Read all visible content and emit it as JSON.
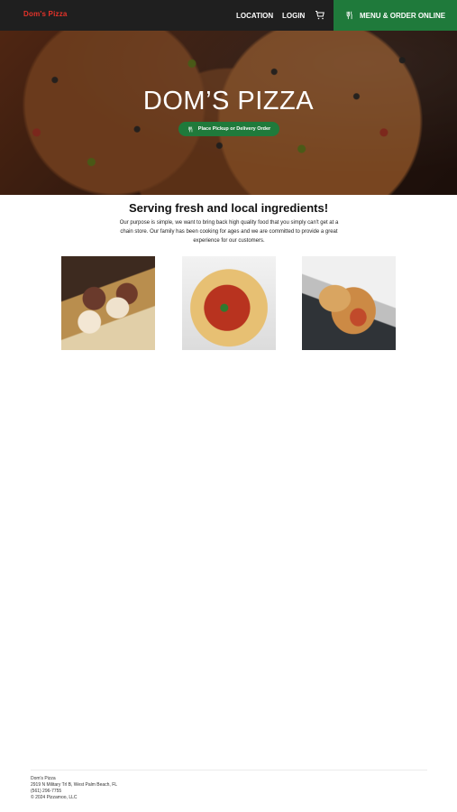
{
  "header": {
    "brand": "Dom's Pizza",
    "nav": {
      "location": "LOCATION",
      "login": "LOGIN"
    },
    "order_button": "MENU & ORDER ONLINE",
    "icons": {
      "cart": "cart-icon",
      "utensils": "utensils-icon"
    }
  },
  "hero": {
    "title": "DOM’S PIZZA",
    "cta": "Place Pickup or Delivery Order"
  },
  "about": {
    "heading": "Serving fresh and local ingredients!",
    "description": "Our purpose is simple, we want to bring back high quality food that you simply can't get at a chain store. Our family has been cooking for ages and we are committed to provide a great experience for our customers."
  },
  "footer": {
    "name": "Dom's Pizza",
    "address": "2919 N Military Trl B, West Palm Beach, FL",
    "phone": "(561) 296-7755",
    "copyright": "© 2024 Pizzamoo, LLC"
  },
  "colors": {
    "header_bg": "#1f1f1f",
    "brand": "#e5332a",
    "accent_green": "#1f7a3b"
  }
}
